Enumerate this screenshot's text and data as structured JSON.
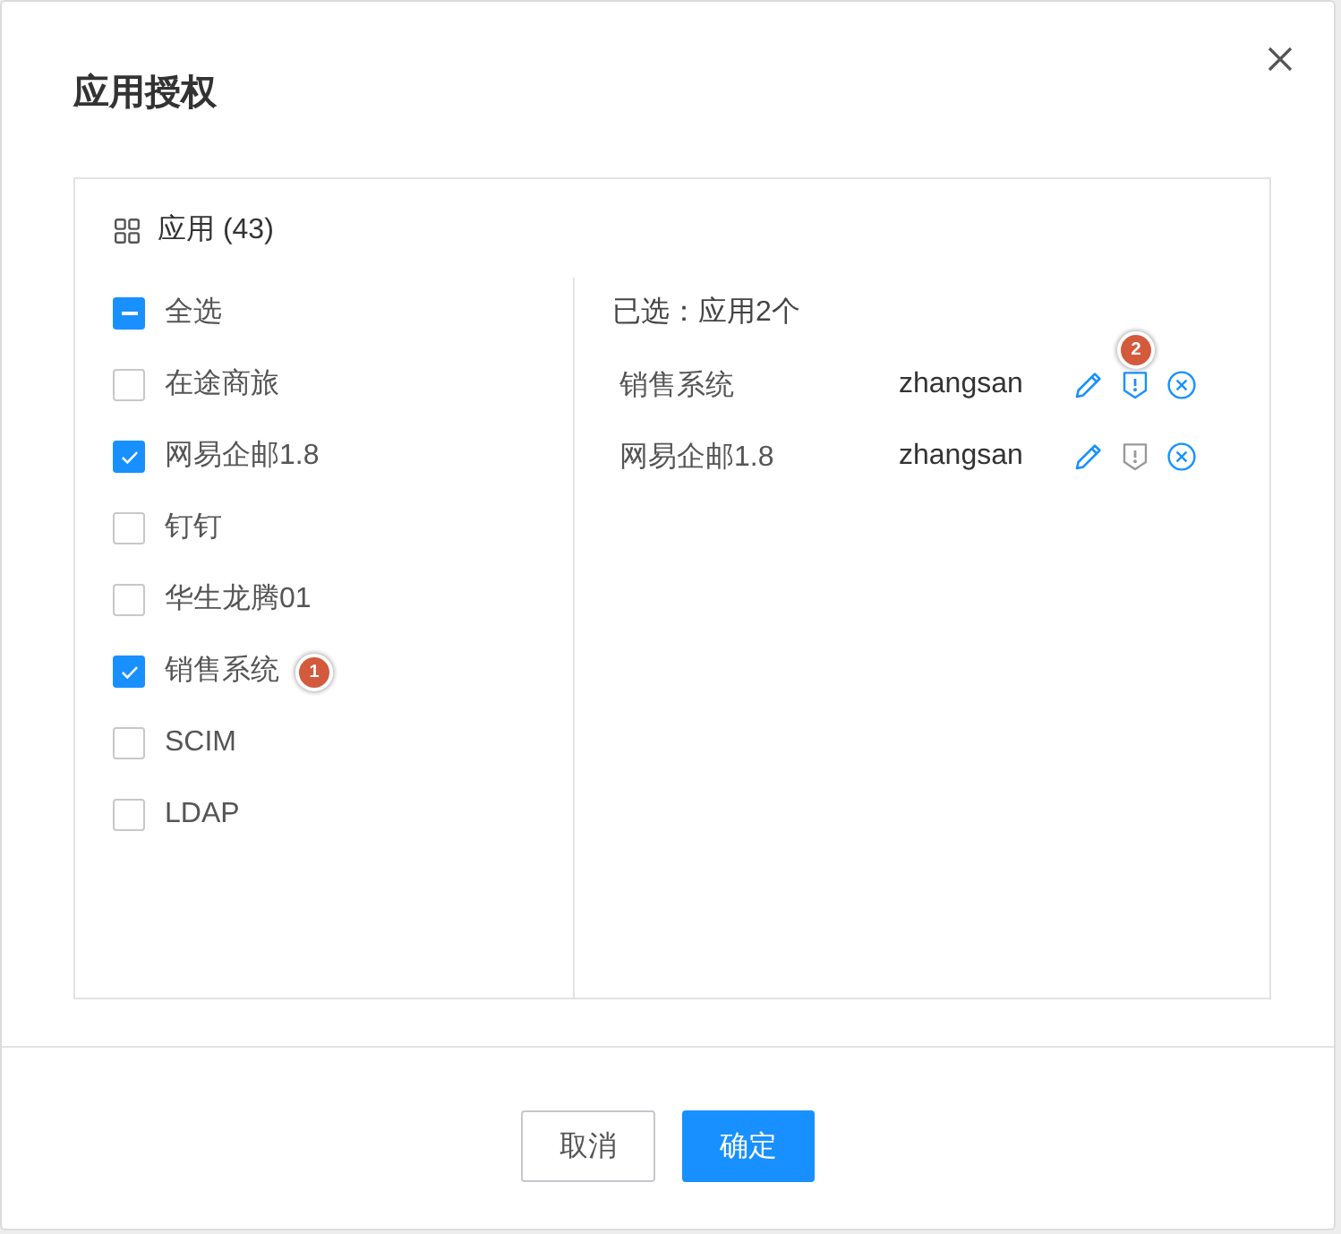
{
  "dialog": {
    "title": "应用授权"
  },
  "panel": {
    "heading": "应用 (43)",
    "select_all": {
      "label": "全选",
      "indeterminate": true
    },
    "apps": [
      {
        "label": "在途商旅",
        "checked": false
      },
      {
        "label": "网易企邮1.8",
        "checked": true
      },
      {
        "label": "钉钉",
        "checked": false
      },
      {
        "label": "华生龙腾01",
        "checked": false
      },
      {
        "label": "销售系统",
        "checked": true,
        "badge": "1"
      },
      {
        "label": "SCIM",
        "checked": false
      },
      {
        "label": "LDAP",
        "checked": false
      }
    ],
    "selected": {
      "heading": "已选：应用2个",
      "rows": [
        {
          "name": "销售系统",
          "user": "zhangsan",
          "shield_on": true,
          "badge": "2"
        },
        {
          "name": "网易企邮1.8",
          "user": "zhangsan",
          "shield_on": false
        }
      ]
    }
  },
  "buttons": [
    {
      "label": "取消",
      "kind": "secondary"
    },
    {
      "label": "确定",
      "kind": "primary"
    }
  ]
}
